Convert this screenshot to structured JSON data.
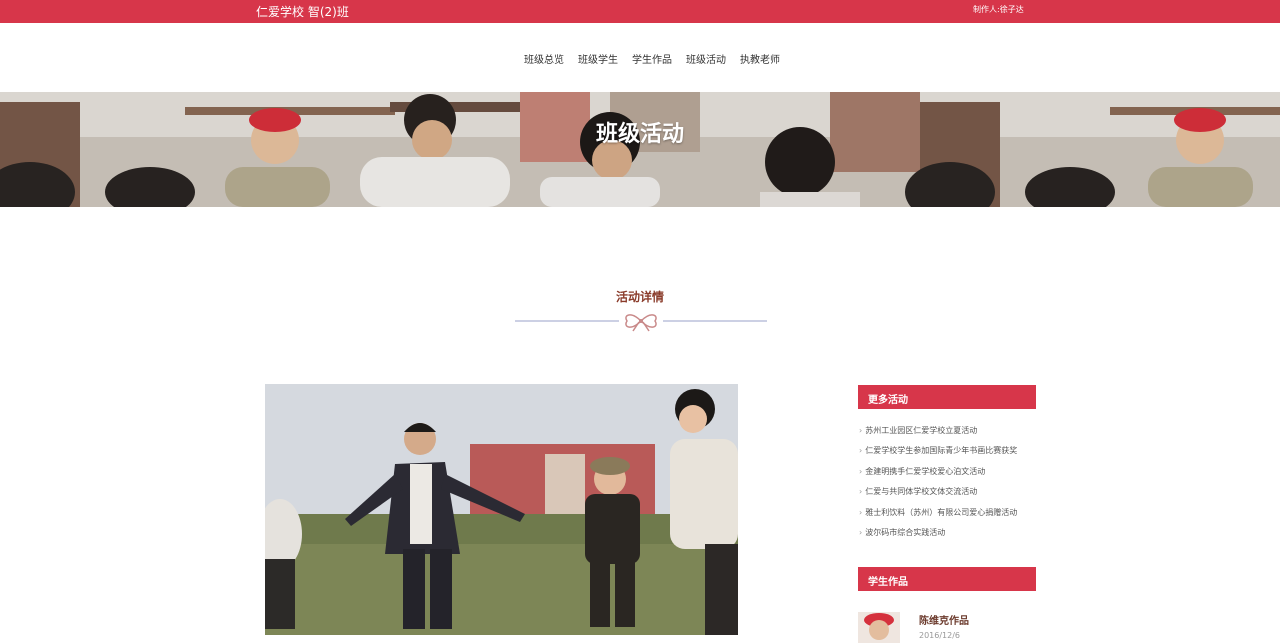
{
  "header": {
    "school_name": "仁爱学校 智(2)班",
    "credit": "制作人:徐子达"
  },
  "nav": {
    "items": [
      {
        "label": "班级总览"
      },
      {
        "label": "班级学生"
      },
      {
        "label": "学生作品"
      },
      {
        "label": "班级活动"
      },
      {
        "label": "执教老师"
      }
    ]
  },
  "hero": {
    "title": "班级活动"
  },
  "section": {
    "title": "活动详情"
  },
  "sidebar": {
    "more_title": "更多活动",
    "more_items": [
      {
        "label": "苏州工业园区仁爱学校立夏活动"
      },
      {
        "label": "仁爱学校学生参加国际青少年书画比赛获奖"
      },
      {
        "label": "金建明携手仁爱学校爱心泊文活动"
      },
      {
        "label": "仁爱与共同体学校文体交流活动"
      },
      {
        "label": "雅士利饮料（苏州）有限公司爱心捐赠活动"
      },
      {
        "label": "波尔码市综合实践活动"
      }
    ],
    "works_title": "学生作品",
    "work": {
      "title": "陈维克作品",
      "date": "2016/12/6"
    }
  },
  "colors": {
    "brand_red": "#d7364a",
    "title_brown": "#8a3b2a"
  }
}
